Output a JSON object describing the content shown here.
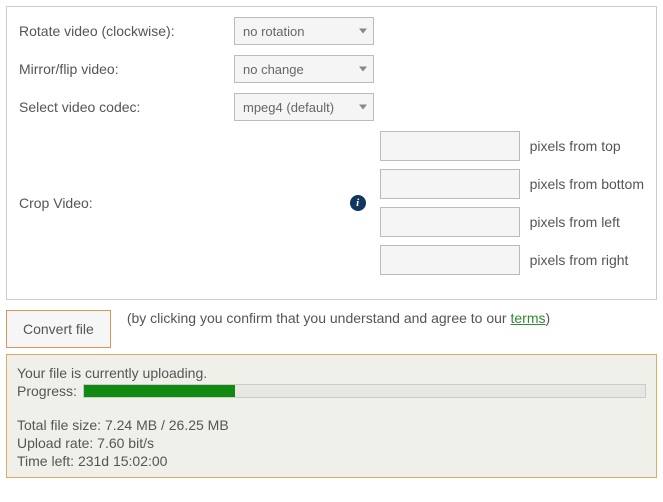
{
  "settings": {
    "rotate_label": "Rotate video (clockwise):",
    "rotate_value": "no rotation",
    "mirror_label": "Mirror/flip video:",
    "mirror_value": "no change",
    "codec_label": "Select video codec:",
    "codec_value": "mpeg4 (default)",
    "crop_label": "Crop Video:",
    "info_glyph": "i",
    "crop": {
      "top": "",
      "bottom": "",
      "left": "",
      "right": "",
      "suffix_top": "pixels from top",
      "suffix_bottom": "pixels from bottom",
      "suffix_left": "pixels from left",
      "suffix_right": "pixels from right"
    }
  },
  "convert": {
    "button": "Convert file",
    "agree_prefix": "(by clicking you confirm that you understand and agree to our ",
    "terms_text": "terms",
    "agree_suffix": ")"
  },
  "upload": {
    "status": "Your file is currently uploading.",
    "progress_label": "Progress:",
    "progress_percent": 27,
    "total_label": "Total file size: ",
    "total_value": "7.24 MB / 26.25 MB",
    "rate_label": "Upload rate: ",
    "rate_value": "7.60 bit/s",
    "time_label": "Time left: ",
    "time_value": "231d 15:02:00"
  }
}
